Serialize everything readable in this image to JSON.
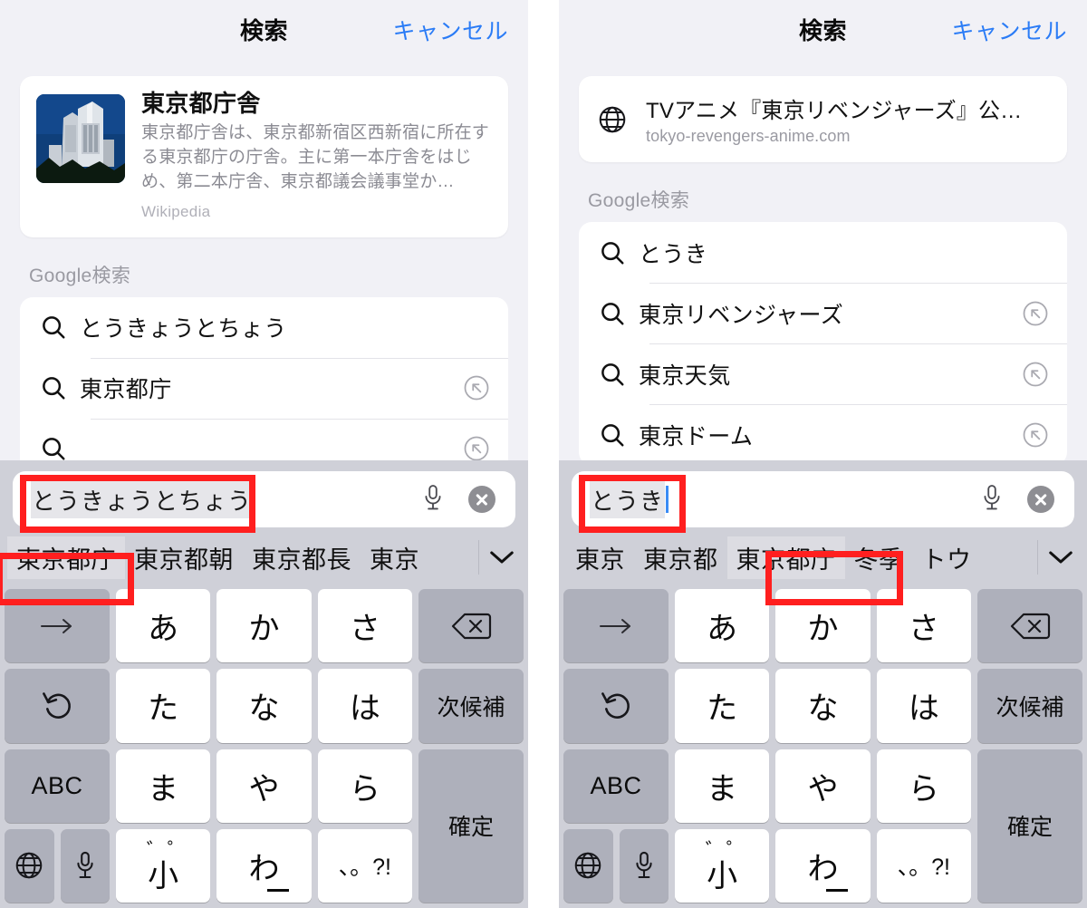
{
  "panels": [
    {
      "id": "left",
      "nav": {
        "title": "検索",
        "cancel": "キャンセル"
      },
      "card": {
        "type": "wikipedia",
        "title": "東京都庁舎",
        "description": "東京都庁舎は、東京都新宿区西新宿に所在する東京都庁の庁舎。主に第一本庁舎をはじめ、第二本庁舎、東京都議会議事堂か…",
        "source": "Wikipedia",
        "thumbnail_alt": "東京都庁舎の写真"
      },
      "section_label": "Google検索",
      "suggestions": [
        {
          "text": "とうきょうとちょう",
          "has_fill": false
        },
        {
          "text": "東京都庁",
          "has_fill": true
        }
      ],
      "keyboard": {
        "input_value": "とうきょうとちょう",
        "input_composing": true,
        "show_caret": false,
        "mic_icon": "microphone-icon",
        "clear_icon": "clear-icon",
        "candidates": [
          {
            "text": "東京都庁",
            "selected": true
          },
          {
            "text": "東京都朝",
            "selected": false
          },
          {
            "text": "東京都長",
            "selected": false
          },
          {
            "text": "東京",
            "selected": false
          }
        ],
        "expand_icon": "chevron-down-icon"
      }
    },
    {
      "id": "right",
      "nav": {
        "title": "検索",
        "cancel": "キャンセル"
      },
      "card": {
        "type": "url",
        "title": "TVアニメ『東京リベンジャーズ』公…",
        "url": "tokyo-revengers-anime.com",
        "icon": "globe-icon"
      },
      "section_label": "Google検索",
      "suggestions": [
        {
          "text": "とうき",
          "has_fill": false
        },
        {
          "text": "東京リベンジャーズ",
          "has_fill": true
        },
        {
          "text": "東京天気",
          "has_fill": true
        },
        {
          "text": "東京ドーム",
          "has_fill": true
        }
      ],
      "keyboard": {
        "input_value": "とうき",
        "input_composing": true,
        "show_caret": true,
        "mic_icon": "microphone-icon",
        "clear_icon": "clear-icon",
        "candidates": [
          {
            "text": "東京",
            "selected": false
          },
          {
            "text": "東京都",
            "selected": false
          },
          {
            "text": "東京都庁",
            "selected": true
          },
          {
            "text": "冬季",
            "selected": false
          },
          {
            "text": "トウ",
            "selected": false
          }
        ],
        "expand_icon": "chevron-down-icon"
      }
    }
  ],
  "keyboard_layout": {
    "rows": [
      [
        {
          "label": "→",
          "style": "dark",
          "name": "cursor-right-key"
        },
        {
          "label": "あ",
          "style": "light",
          "name": "a-row-key"
        },
        {
          "label": "か",
          "style": "light",
          "name": "ka-row-key"
        },
        {
          "label": "さ",
          "style": "light",
          "name": "sa-row-key"
        },
        {
          "label": "",
          "style": "dark",
          "name": "backspace-key"
        }
      ],
      [
        {
          "label": "↺",
          "style": "dark",
          "name": "undo-key"
        },
        {
          "label": "た",
          "style": "light",
          "name": "ta-row-key"
        },
        {
          "label": "な",
          "style": "light",
          "name": "na-row-key"
        },
        {
          "label": "は",
          "style": "light",
          "name": "ha-row-key"
        },
        {
          "label": "次候補",
          "style": "dark",
          "name": "next-candidate-key"
        }
      ],
      [
        {
          "label": "ABC",
          "style": "dark",
          "name": "abc-key"
        },
        {
          "label": "ま",
          "style": "light",
          "name": "ma-row-key"
        },
        {
          "label": "や",
          "style": "light",
          "name": "ya-row-key"
        },
        {
          "label": "ら",
          "style": "light",
          "name": "ra-row-key"
        },
        {
          "label": "確定",
          "style": "dark",
          "name": "confirm-key"
        }
      ],
      [
        {
          "label": "",
          "style": "dark",
          "name": "globe-key"
        },
        {
          "label": "小",
          "style": "light",
          "name": "small-kana-key",
          "marks": "゛゜"
        },
        {
          "label": "わ",
          "style": "light",
          "name": "wa-row-key"
        },
        {
          "label": "、。?!",
          "style": "light",
          "name": "punctuation-key"
        }
      ]
    ],
    "globe_key": "globe-icon",
    "mic_key": "microphone-icon"
  },
  "annotations": {
    "highlight_color": "#ff1f1f",
    "boxes": [
      {
        "panel": "left",
        "target": "input-text",
        "label": "とうきょうとちょう"
      },
      {
        "panel": "left",
        "target": "selected-candidate",
        "label": "東京都庁"
      },
      {
        "panel": "right",
        "target": "input-text",
        "label": "とうき"
      },
      {
        "panel": "right",
        "target": "selected-candidate",
        "label": "東京都庁"
      }
    ]
  }
}
